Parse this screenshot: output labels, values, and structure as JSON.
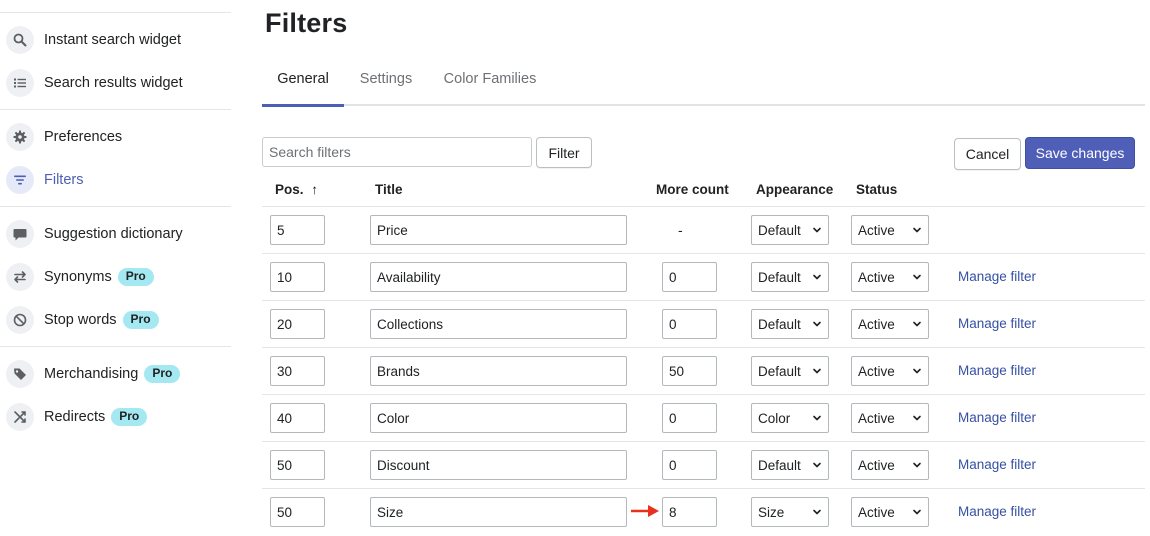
{
  "sidebar": {
    "items": [
      {
        "label": "Instant search widget",
        "icon": "search-icon"
      },
      {
        "label": "Search results widget",
        "icon": "list-icon"
      },
      {
        "label": "Preferences",
        "icon": "gear-icon"
      },
      {
        "label": "Filters",
        "icon": "filter-icon",
        "active": true
      },
      {
        "label": "Suggestion dictionary",
        "icon": "chat-icon"
      },
      {
        "label": "Synonyms",
        "icon": "swap-icon",
        "badge": "Pro"
      },
      {
        "label": "Stop words",
        "icon": "block-icon",
        "badge": "Pro"
      },
      {
        "label": "Merchandising",
        "icon": "tag-icon",
        "badge": "Pro"
      },
      {
        "label": "Redirects",
        "icon": "shuffle-icon",
        "badge": "Pro"
      }
    ]
  },
  "page": {
    "title": "Filters"
  },
  "tabs": [
    {
      "label": "General",
      "active": true
    },
    {
      "label": "Settings"
    },
    {
      "label": "Color Families"
    }
  ],
  "toolbar": {
    "search_placeholder": "Search filters",
    "filter_label": "Filter",
    "cancel_label": "Cancel",
    "save_label": "Save changes"
  },
  "table": {
    "headers": {
      "pos": "Pos.",
      "sort_indicator": "↑",
      "title": "Title",
      "more_count": "More count",
      "appearance": "Appearance",
      "status": "Status"
    },
    "manage_label": "Manage filter",
    "rows": [
      {
        "pos": "5",
        "title": "Price",
        "more_count": "-",
        "appearance": "Default",
        "status": "Active",
        "manage": ""
      },
      {
        "pos": "10",
        "title": "Availability",
        "more_count": "0",
        "appearance": "Default",
        "status": "Active",
        "manage": "Manage filter"
      },
      {
        "pos": "20",
        "title": "Collections",
        "more_count": "0",
        "appearance": "Default",
        "status": "Active",
        "manage": "Manage filter"
      },
      {
        "pos": "30",
        "title": "Brands",
        "more_count": "50",
        "appearance": "Default",
        "status": "Active",
        "manage": "Manage filter"
      },
      {
        "pos": "40",
        "title": "Color",
        "more_count": "0",
        "appearance": "Color",
        "status": "Active",
        "manage": "Manage filter"
      },
      {
        "pos": "50",
        "title": "Discount",
        "more_count": "0",
        "appearance": "Default",
        "status": "Active",
        "manage": "Manage filter"
      },
      {
        "pos": "50",
        "title": "Size",
        "more_count": "8",
        "appearance": "Size",
        "status": "Active",
        "manage": "Manage filter"
      }
    ]
  },
  "colors": {
    "accent": "#4c5fb5",
    "primary_button": "#4f5fb8",
    "badge": "#a4e8f2",
    "link": "#3650a3",
    "annotation_arrow": "#e8321e"
  }
}
